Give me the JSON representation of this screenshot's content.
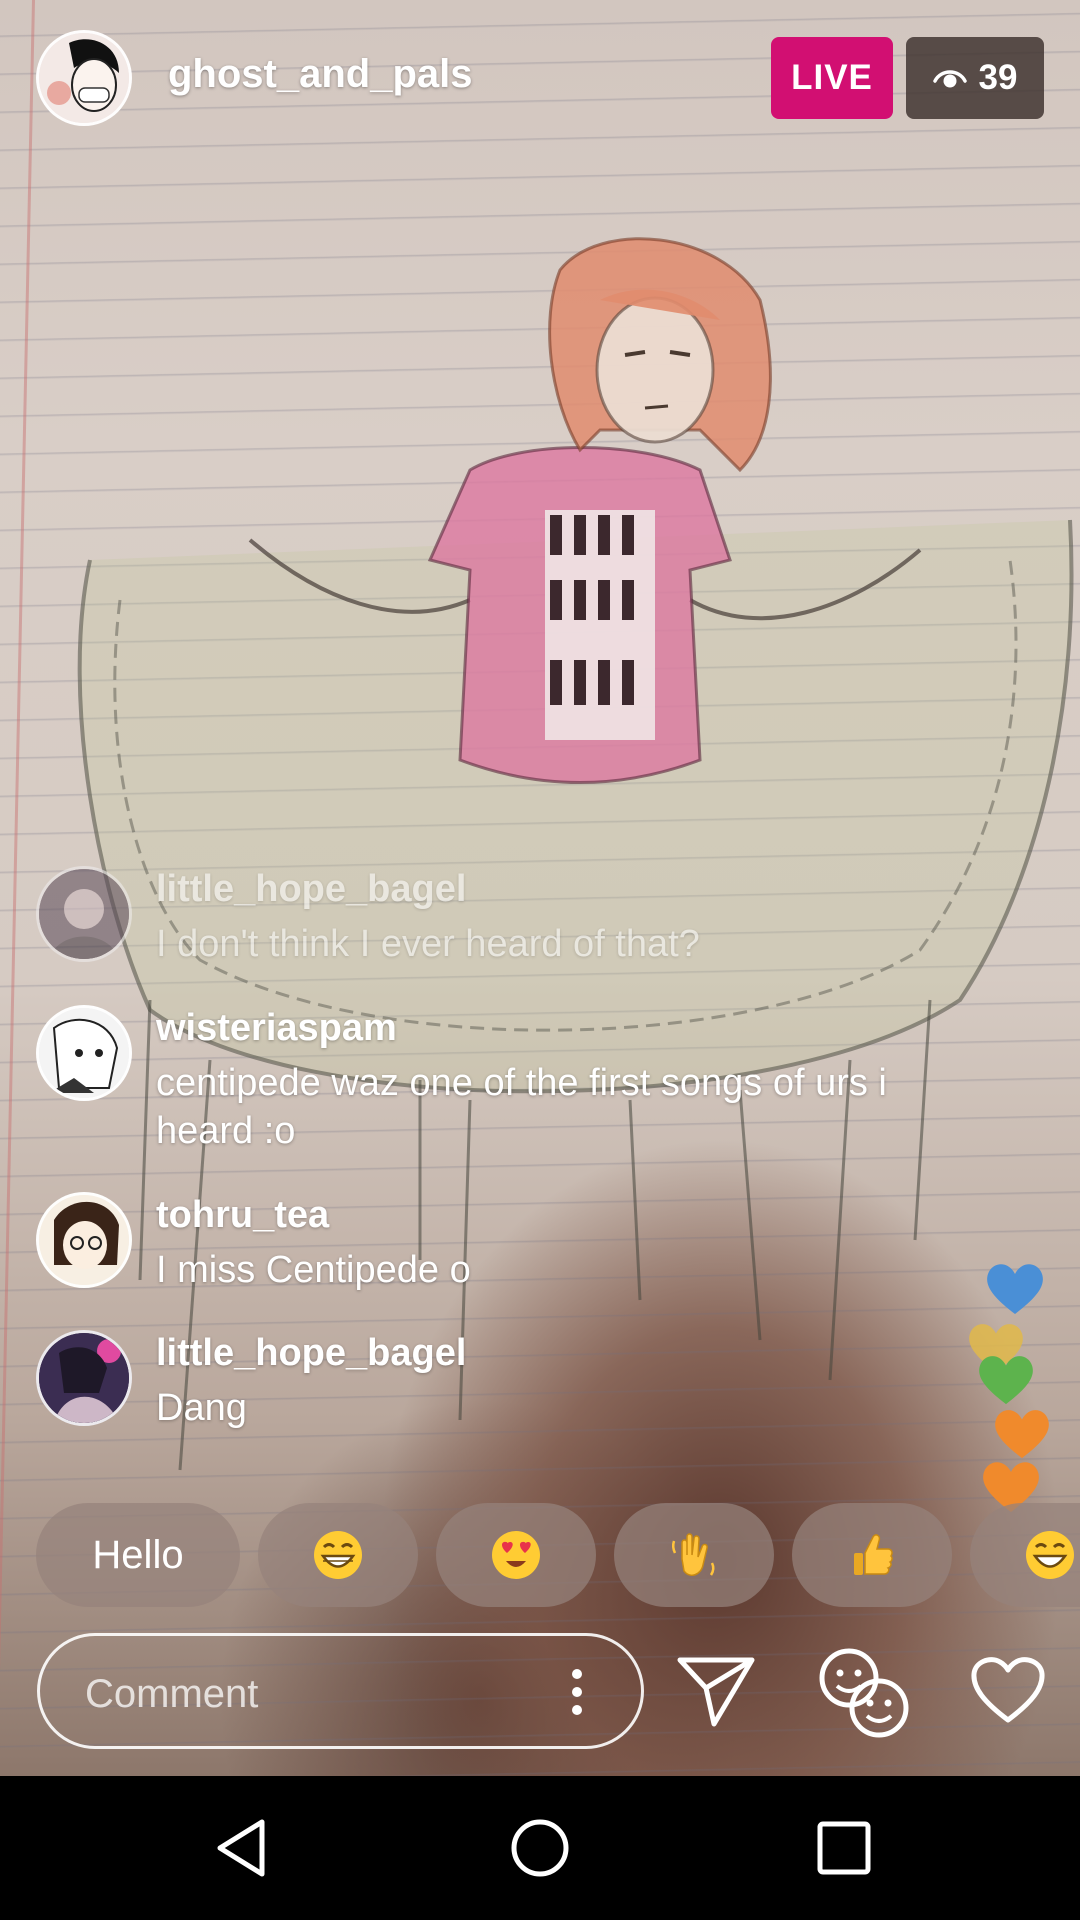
{
  "header": {
    "username": "ghost_and_pals",
    "live_label": "LIVE",
    "viewer_count": "39"
  },
  "comments": [
    {
      "username": "little_hope_bagel",
      "text": "I don't think I ever heard of that?"
    },
    {
      "username": "wisteriaspam",
      "text": "centipede waz one of the first songs of urs i heard :o"
    },
    {
      "username": "tohru_tea",
      "text": "I miss Centipede o"
    },
    {
      "username": "little_hope_bagel",
      "text": "Dang"
    }
  ],
  "quick_reactions": {
    "hello_label": "Hello",
    "items": [
      "grinning-face",
      "heart-eyes-face",
      "waving-hand",
      "thumbs-up",
      "grinning-face"
    ]
  },
  "comment_bar": {
    "placeholder": "Comment"
  },
  "hearts": [
    "#4a8fd6",
    "#e0b84a",
    "#5db34d",
    "#f08a2c",
    "#f08a2c"
  ],
  "colors": {
    "live_badge": "#d20f72",
    "viewer_badge": "#3c302c"
  }
}
